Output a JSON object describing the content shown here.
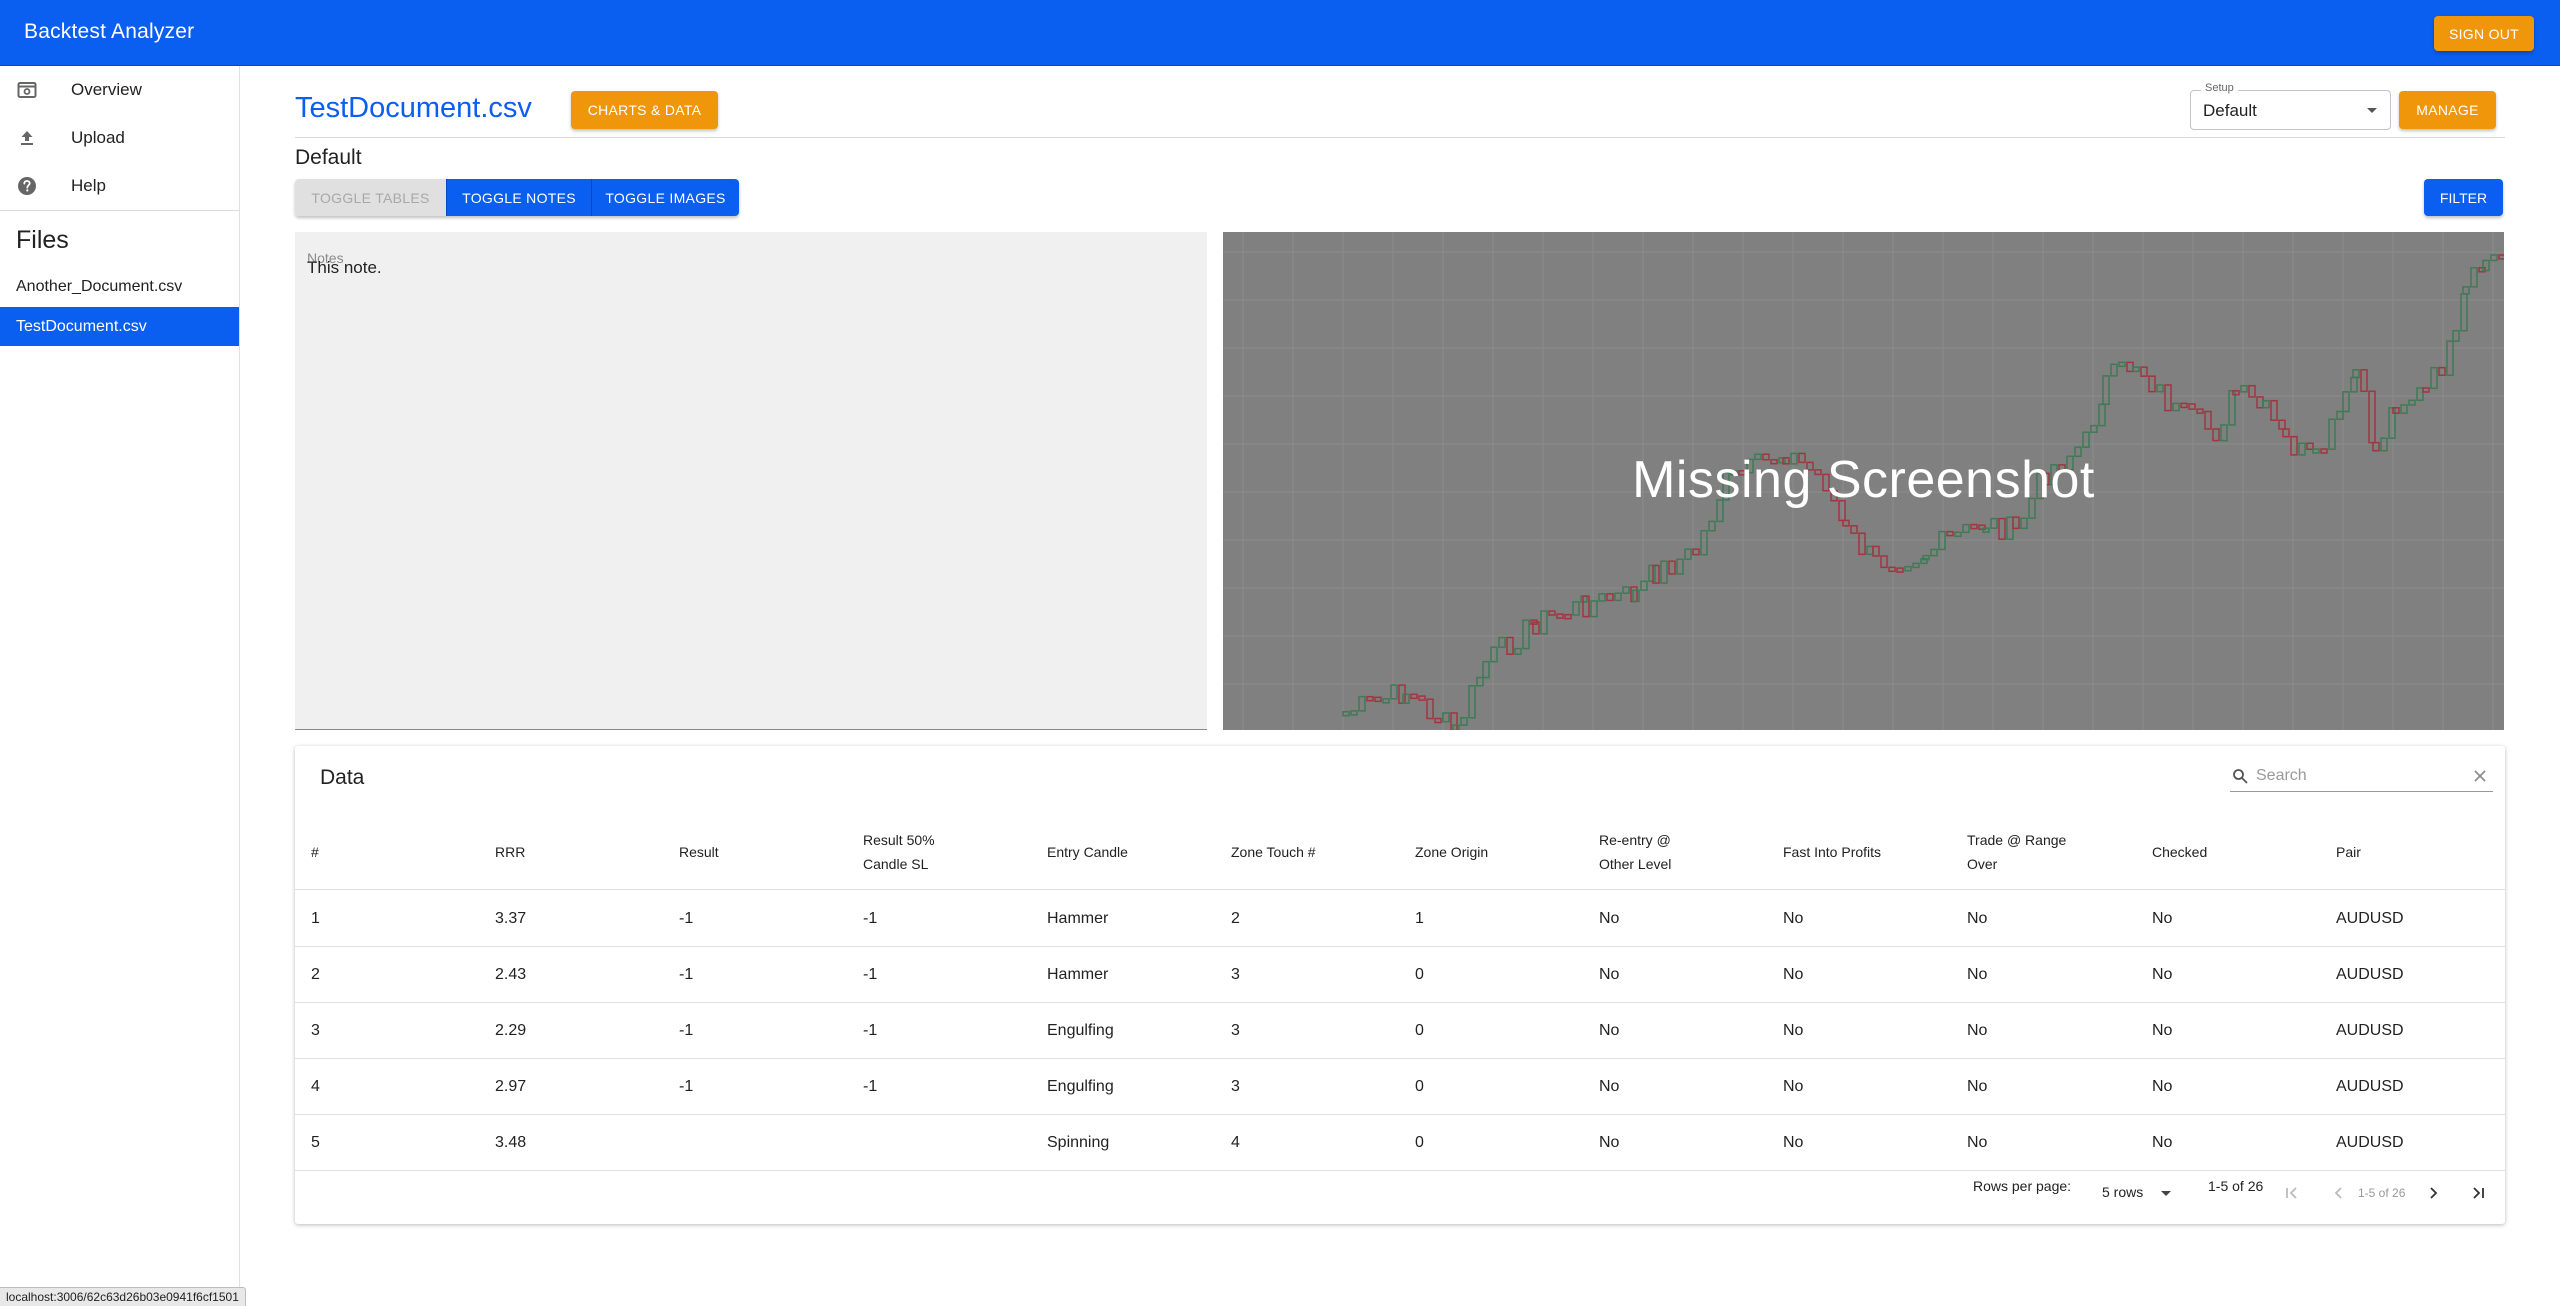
{
  "app": {
    "title": "Backtest Analyzer",
    "signout_label": "SIGN OUT",
    "brand_color": "#0a5ef0",
    "accent_color": "#f0960a"
  },
  "sidebar": {
    "nav": [
      {
        "label": "Overview",
        "icon": "overview-icon"
      },
      {
        "label": "Upload",
        "icon": "upload-icon"
      },
      {
        "label": "Help",
        "icon": "help-icon"
      }
    ],
    "files_heading": "Files",
    "files": [
      {
        "label": "Another_Document.csv",
        "active": false
      },
      {
        "label": "TestDocument.csv",
        "active": true
      }
    ]
  },
  "header": {
    "document_title": "TestDocument.csv",
    "charts_button": "CHARTS & DATA",
    "setup_label": "Setup",
    "setup_value": "Default",
    "manage_button": "MANAGE"
  },
  "toolbar": {
    "setup_name": "Default",
    "toggle_tables": "TOGGLE TABLES",
    "toggle_notes": "TOGGLE NOTES",
    "toggle_images": "TOGGLE IMAGES",
    "filter": "FILTER"
  },
  "notes": {
    "label": "Notes",
    "text": "This note."
  },
  "screenshot": {
    "overlay_text": "Missing Screenshot"
  },
  "data_table": {
    "title": "Data",
    "search_placeholder": "Search",
    "columns": [
      [
        "#"
      ],
      [
        "RRR"
      ],
      [
        "Result"
      ],
      [
        "Result 50%",
        "Candle SL"
      ],
      [
        "Entry Candle"
      ],
      [
        "Zone Touch #"
      ],
      [
        "Zone Origin"
      ],
      [
        "Re-entry @",
        "Other Level"
      ],
      [
        "Fast Into Profits"
      ],
      [
        "Trade @ Range",
        "Over"
      ],
      [
        "Checked"
      ],
      [
        "Pair"
      ]
    ],
    "rows": [
      [
        "1",
        "3.37",
        "-1",
        "-1",
        "Hammer",
        "2",
        "1",
        "No",
        "No",
        "No",
        "No",
        "AUDUSD"
      ],
      [
        "2",
        "2.43",
        "-1",
        "-1",
        "Hammer",
        "3",
        "0",
        "No",
        "No",
        "No",
        "No",
        "AUDUSD"
      ],
      [
        "3",
        "2.29",
        "-1",
        "-1",
        "Engulfing",
        "3",
        "0",
        "No",
        "No",
        "No",
        "No",
        "AUDUSD"
      ],
      [
        "4",
        "2.97",
        "-1",
        "-1",
        "Engulfing",
        "3",
        "0",
        "No",
        "No",
        "No",
        "No",
        "AUDUSD"
      ],
      [
        "5",
        "3.48",
        "",
        "",
        "Spinning",
        "4",
        "0",
        "No",
        "No",
        "No",
        "No",
        "AUDUSD"
      ]
    ],
    "rows_per_page_label": "Rows per page:",
    "rows_per_page_value": "5 rows",
    "range_label": "1-5 of 26",
    "range_label_small": "1-5 of 26"
  },
  "status_bar": {
    "url": "localhost:3006/62c63d26b03e0941f6cf1501"
  }
}
